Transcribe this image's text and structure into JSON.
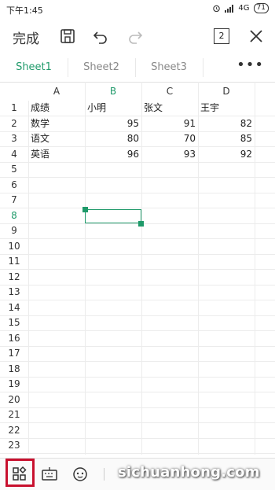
{
  "status": {
    "time": "下午1:45",
    "network": "4G",
    "battery": "71"
  },
  "toolbar": {
    "done_label": "完成",
    "page_count": "2"
  },
  "tabs": [
    {
      "label": "Sheet1",
      "active": true
    },
    {
      "label": "Sheet2",
      "active": false
    },
    {
      "label": "Sheet3",
      "active": false
    }
  ],
  "more_label": "•••",
  "columns": [
    "A",
    "B",
    "C",
    "D"
  ],
  "rows": [
    {
      "num": "1",
      "cells": [
        "成绩",
        "小明",
        "张文",
        "王宇"
      ]
    },
    {
      "num": "2",
      "cells": [
        "数学",
        "95",
        "91",
        "82"
      ]
    },
    {
      "num": "3",
      "cells": [
        "语文",
        "80",
        "70",
        "85"
      ]
    },
    {
      "num": "4",
      "cells": [
        "英语",
        "96",
        "93",
        "92"
      ]
    },
    {
      "num": "5",
      "cells": [
        "",
        "",
        "",
        ""
      ]
    },
    {
      "num": "6",
      "cells": [
        "",
        "",
        "",
        ""
      ]
    },
    {
      "num": "7",
      "cells": [
        "",
        "",
        "",
        ""
      ]
    },
    {
      "num": "8",
      "cells": [
        "",
        "",
        "",
        ""
      ]
    },
    {
      "num": "9",
      "cells": [
        "",
        "",
        "",
        ""
      ]
    },
    {
      "num": "10",
      "cells": [
        "",
        "",
        "",
        ""
      ]
    },
    {
      "num": "11",
      "cells": [
        "",
        "",
        "",
        ""
      ]
    },
    {
      "num": "12",
      "cells": [
        "",
        "",
        "",
        ""
      ]
    },
    {
      "num": "13",
      "cells": [
        "",
        "",
        "",
        ""
      ]
    },
    {
      "num": "14",
      "cells": [
        "",
        "",
        "",
        ""
      ]
    },
    {
      "num": "15",
      "cells": [
        "",
        "",
        "",
        ""
      ]
    },
    {
      "num": "16",
      "cells": [
        "",
        "",
        "",
        ""
      ]
    },
    {
      "num": "17",
      "cells": [
        "",
        "",
        "",
        ""
      ]
    },
    {
      "num": "18",
      "cells": [
        "",
        "",
        "",
        ""
      ]
    },
    {
      "num": "19",
      "cells": [
        "",
        "",
        "",
        ""
      ]
    },
    {
      "num": "20",
      "cells": [
        "",
        "",
        "",
        ""
      ]
    },
    {
      "num": "21",
      "cells": [
        "",
        "",
        "",
        ""
      ]
    },
    {
      "num": "22",
      "cells": [
        "",
        "",
        "",
        ""
      ]
    },
    {
      "num": "23",
      "cells": [
        "",
        "",
        "",
        ""
      ]
    }
  ],
  "selected_cell": "B8",
  "accent_color": "#1f9a6a",
  "watermark": "sichuanhong.com",
  "icons": [
    "alarm-icon",
    "signal-icon",
    "battery-icon",
    "save-icon",
    "undo-icon",
    "redo-icon",
    "page-count-icon",
    "close-icon",
    "grid-menu-icon",
    "keyboard-icon",
    "emoji-icon"
  ]
}
